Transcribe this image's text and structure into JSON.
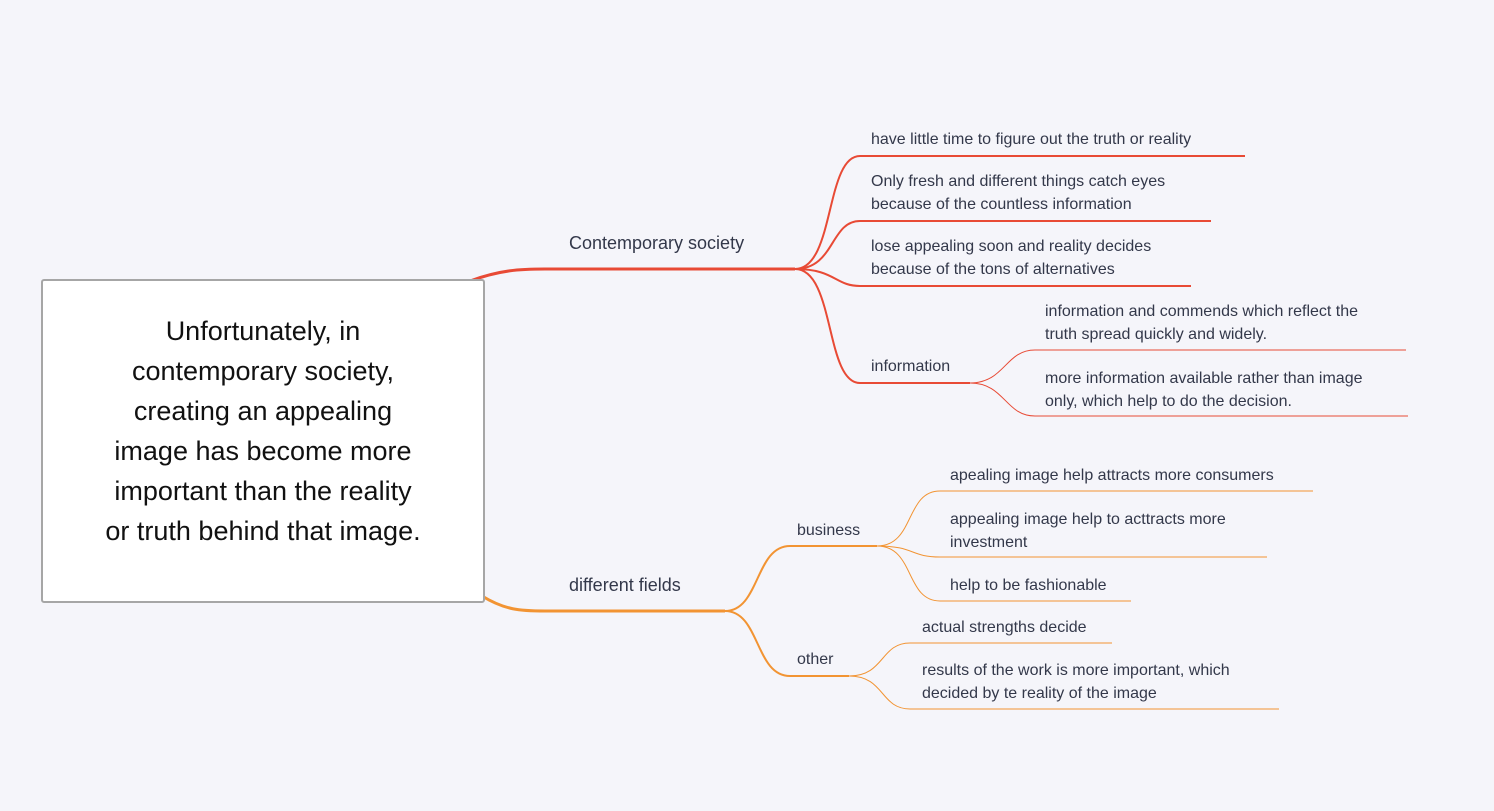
{
  "colors": {
    "branch_red": "#e84a35",
    "branch_orange": "#f29433",
    "text": "#33384a",
    "root_border": "#a6a6a6",
    "background": "#f5f5fa"
  },
  "mindmap": {
    "root": {
      "lines": [
        "Unfortunately, in",
        "contemporary society,",
        "creating an appealing",
        "image has become more",
        "important than the reality",
        "or truth behind that image."
      ]
    },
    "branches": [
      {
        "label": "Contemporary  society",
        "color": "red",
        "children": [
          {
            "lines": [
              "have little time to figure out the truth or reality"
            ]
          },
          {
            "lines": [
              "Only fresh and different things catch eyes",
              "because of the countless information"
            ]
          },
          {
            "lines": [
              "lose appealing soon and reality decides",
              "because of the tons of alternatives"
            ]
          },
          {
            "label": "information",
            "children": [
              {
                "lines": [
                  "information and commends which reflect the",
                  "truth spread quickly and widely."
                ]
              },
              {
                "lines": [
                  "more information available rather than image",
                  "only, which help to do the decision."
                ]
              }
            ]
          }
        ]
      },
      {
        "label": "different fields",
        "color": "orange",
        "children": [
          {
            "label": "business",
            "children": [
              {
                "lines": [
                  "apealing image help attracts more consumers"
                ]
              },
              {
                "lines": [
                  "appealing image help to acttracts more",
                  "investment"
                ]
              },
              {
                "lines": [
                  "help to be fashionable"
                ]
              }
            ]
          },
          {
            "label": "other",
            "children": [
              {
                "lines": [
                  "actual strengths decide"
                ]
              },
              {
                "lines": [
                  "results of the work is more important, which",
                  "decided by te reality of the image"
                ]
              }
            ]
          }
        ]
      }
    ]
  }
}
